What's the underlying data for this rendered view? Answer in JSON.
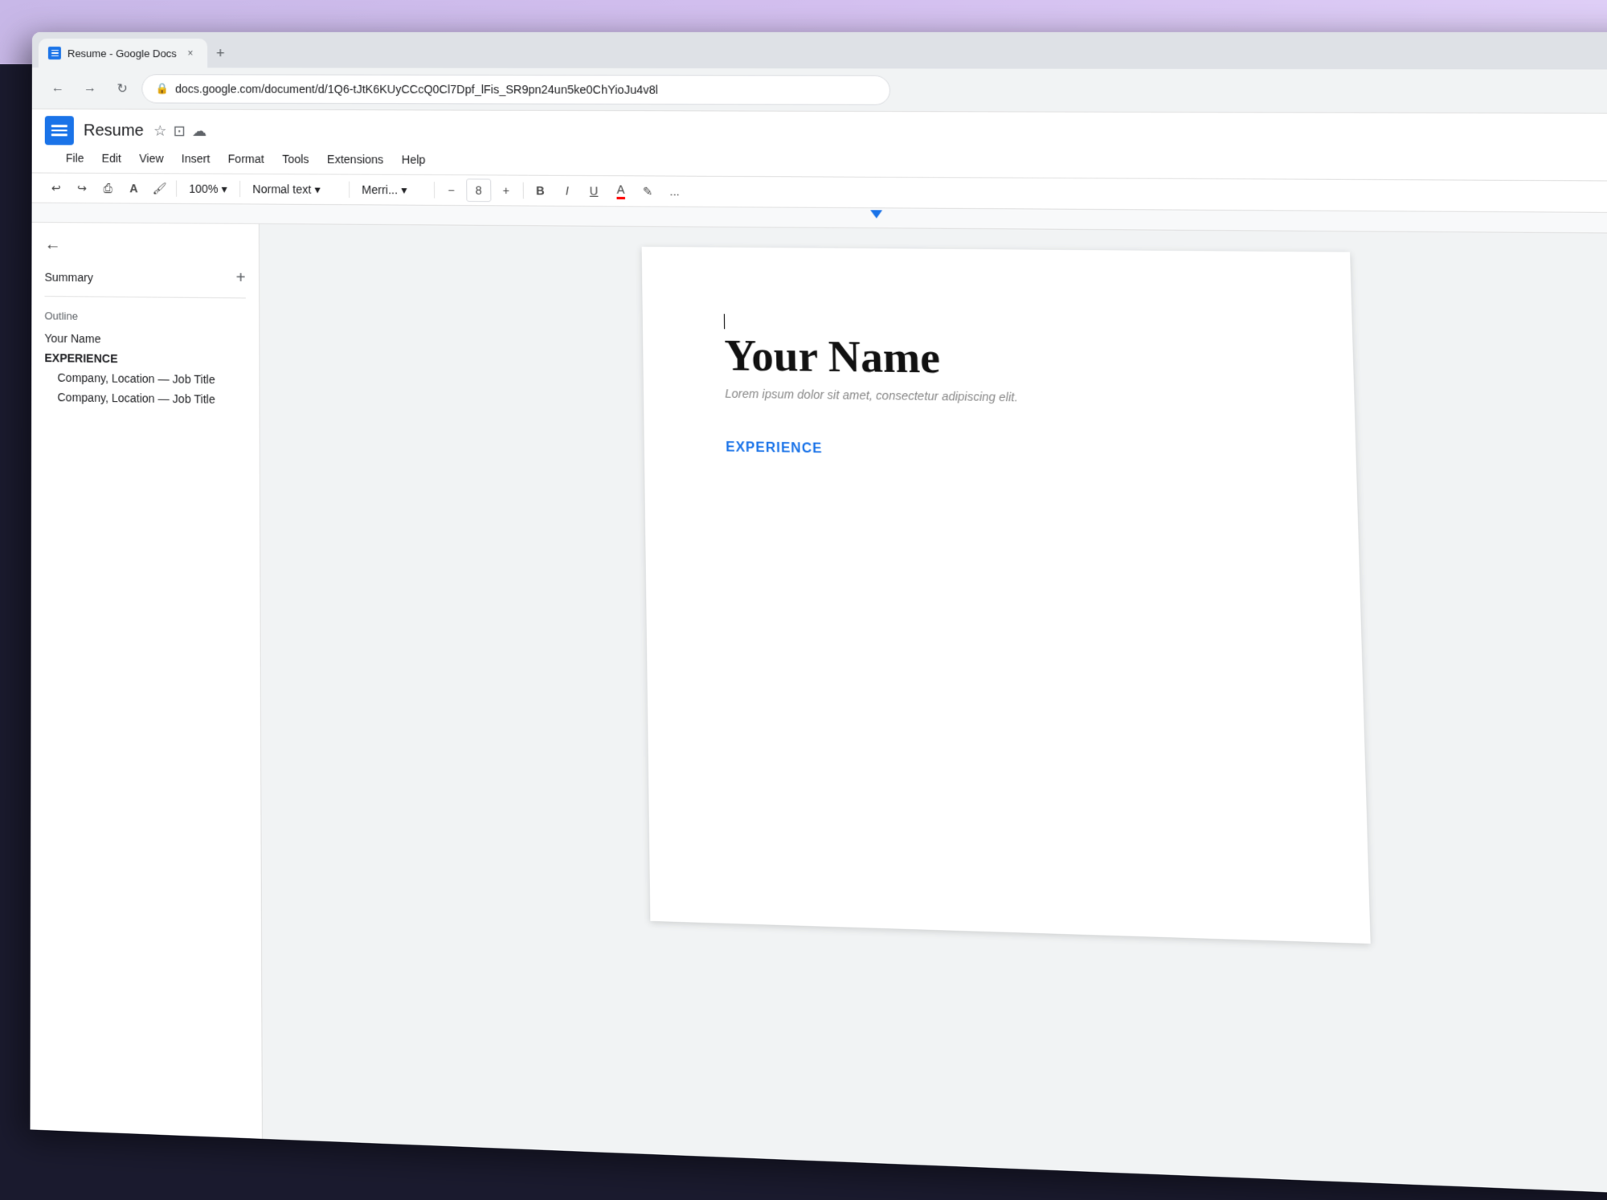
{
  "browser": {
    "tab": {
      "title": "Resume - Google Docs",
      "close_label": "×",
      "new_tab_label": "+"
    },
    "address_bar": {
      "url": "docs.google.com/document/d/1Q6-tJtK6KUyCCcQ0Cl7Dpf_lFis_SR9pn24un5ke0ChYioJu4v8l"
    },
    "nav": {
      "back_label": "←",
      "forward_label": "→",
      "refresh_label": "↻"
    }
  },
  "docs": {
    "title": "Resume",
    "icons": {
      "star": "☆",
      "drive": "⊡",
      "cloud": "☁"
    },
    "menu": {
      "items": [
        "File",
        "Edit",
        "View",
        "Insert",
        "Format",
        "Tools",
        "Extensions",
        "Help"
      ]
    },
    "toolbar": {
      "undo_label": "↩",
      "redo_label": "↪",
      "print_label": "⎙",
      "spellcheck_label": "A",
      "paint_format_label": "🖌",
      "zoom_label": "100%",
      "zoom_arrow": "▾",
      "style_label": "Normal text",
      "style_arrow": "▾",
      "font_label": "Merri...",
      "font_arrow": "▾",
      "font_size_decrease": "−",
      "font_size_value": "8",
      "font_size_increase": "+",
      "bold_label": "B",
      "italic_label": "I",
      "underline_label": "U",
      "text_color_label": "A",
      "highlight_label": "✎",
      "more_label": "..."
    },
    "sidebar": {
      "back_label": "←",
      "summary_label": "Summary",
      "add_label": "+",
      "outline_label": "Outline",
      "items": [
        {
          "text": "Your Name",
          "type": "normal"
        },
        {
          "text": "EXPERIENCE",
          "type": "bold"
        },
        {
          "text": "Company, Location — Job Title",
          "type": "indent"
        },
        {
          "text": "Company, Location — Job Title",
          "type": "indent"
        }
      ]
    },
    "document": {
      "name": "Your Name",
      "subtitle": "Lorem ipsum dolor sit amet, consectetur adipiscing elit.",
      "section_experience": "EXPERIENCE"
    }
  }
}
